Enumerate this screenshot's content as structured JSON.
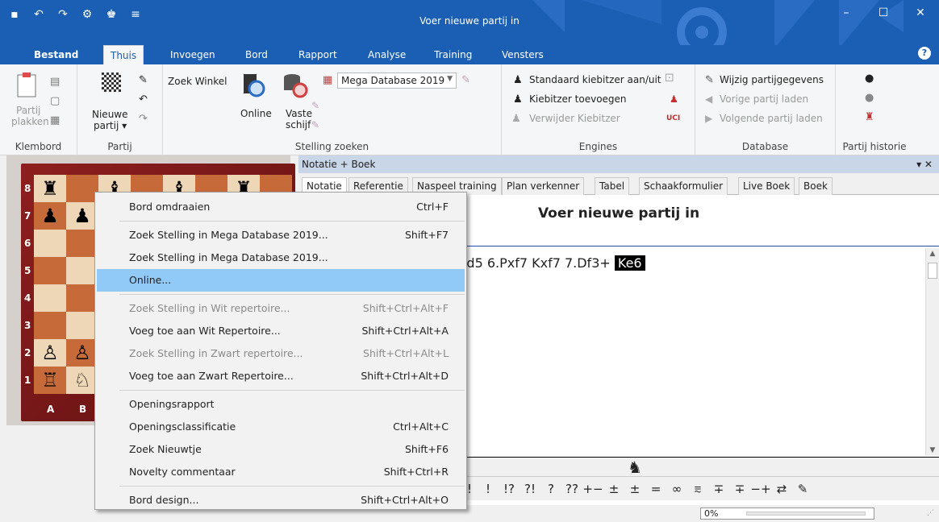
{
  "window": {
    "title": "Voer nieuwe partij in"
  },
  "ribbon_tabs": [
    "Bestand",
    "Thuis",
    "Invoegen",
    "Bord",
    "Rapport",
    "Analyse",
    "Training",
    "Vensters"
  ],
  "ribbon": {
    "klembord": {
      "label": "Klembord",
      "paste_line1": "Partij",
      "paste_line2": "plakken"
    },
    "partij": {
      "label": "Partij",
      "new_line1": "Nieuwe",
      "new_line2": "partij ▾"
    },
    "stelling": {
      "label": "Stelling zoeken",
      "zoek_winkel": "Zoek Winkel",
      "online": "Online",
      "vaste1": "Vaste",
      "vaste2": "schijf",
      "db_select": "Mega Database 2019"
    },
    "engines": {
      "label": "Engines",
      "item1": "Standaard kiebitzer aan/uit",
      "item2": "Kiebitzer toevoegen",
      "item3": "Verwijder Kiebitzer"
    },
    "database": {
      "label": "Database",
      "item1": "Wijzig partijgegevens",
      "item2": "Vorige partij laden",
      "item3": "Volgende partij laden"
    },
    "historie": {
      "label": "Partij historie"
    }
  },
  "board": {
    "ranks": [
      "8",
      "7",
      "6",
      "5",
      "4",
      "3",
      "2",
      "1"
    ],
    "files": [
      "A",
      "B"
    ],
    "pieces": [
      [
        "♜",
        "",
        "♝",
        "",
        "♝",
        "",
        "♜",
        ""
      ],
      [
        "♟",
        "♟",
        "",
        "",
        "",
        "",
        "",
        ""
      ],
      [
        "",
        "",
        "",
        "",
        "",
        "",
        "",
        ""
      ],
      [
        "",
        "",
        "",
        "",
        "",
        "",
        "",
        ""
      ],
      [
        "",
        "",
        "",
        "",
        "",
        "",
        "",
        ""
      ],
      [
        "",
        "",
        "",
        "",
        "",
        "",
        "",
        ""
      ],
      [
        "♙",
        "♙",
        "",
        "",
        "",
        "",
        "",
        ""
      ],
      [
        "♖",
        "♘",
        "",
        "",
        "",
        "",
        "",
        ""
      ]
    ]
  },
  "notation": {
    "panel_title": "Notatie + Boek",
    "tabs": [
      "Notatie",
      "Referentie",
      "Naspeel training",
      "Plan verkenner",
      "Tabel",
      "Schaakformulier",
      "Live Boek",
      "Boek"
    ],
    "game_title": "Voer nieuwe partij in",
    "moves_text": "4 Pf6 4.Pg5 d5 5.exd5 Pxd5 6.Pxf7 Kxf7 7.Df3+",
    "current_move": "Ke6"
  },
  "symbols": [
    "!!",
    "!",
    "!?",
    "?!",
    "?",
    "??",
    "+−",
    "±",
    "±",
    "=",
    "∞",
    "⩳",
    "∓",
    "∓",
    "−+",
    "⇄",
    "✎"
  ],
  "status": {
    "progress": "0%"
  },
  "context_menu": [
    {
      "label": "Bord omdraaien",
      "shortcut": "Ctrl+F",
      "state": "normal"
    },
    {
      "label": "Zoek Stelling in Mega Database 2019...",
      "shortcut": "Shift+F7",
      "state": "normal"
    },
    {
      "label": "Zoek Stelling in Mega Database 2019...",
      "shortcut": "",
      "state": "normal"
    },
    {
      "label": "Online...",
      "shortcut": "",
      "state": "highlighted"
    },
    {
      "label": "Zoek Stelling in Wit repertoire...",
      "shortcut": "Shift+Ctrl+Alt+F",
      "state": "disabled"
    },
    {
      "label": "Voeg toe aan Wit Repertoire...",
      "shortcut": "Shift+Ctrl+Alt+A",
      "state": "normal"
    },
    {
      "label": "Zoek Stelling in Zwart repertoire...",
      "shortcut": "Shift+Ctrl+Alt+L",
      "state": "disabled"
    },
    {
      "label": "Voeg toe aan Zwart Repertoire...",
      "shortcut": "Shift+Ctrl+Alt+D",
      "state": "normal"
    },
    {
      "label": "Openingsrapport",
      "shortcut": "",
      "state": "normal"
    },
    {
      "label": "Openingsclassificatie",
      "shortcut": "Ctrl+Alt+C",
      "state": "normal"
    },
    {
      "label": "Zoek Nieuwtje",
      "shortcut": "Shift+F6",
      "state": "normal"
    },
    {
      "label": "Novelty commentaar",
      "shortcut": "Shift+Ctrl+R",
      "state": "normal"
    },
    {
      "label": "Bord design...",
      "shortcut": "Shift+Ctrl+Alt+O",
      "state": "normal"
    }
  ]
}
